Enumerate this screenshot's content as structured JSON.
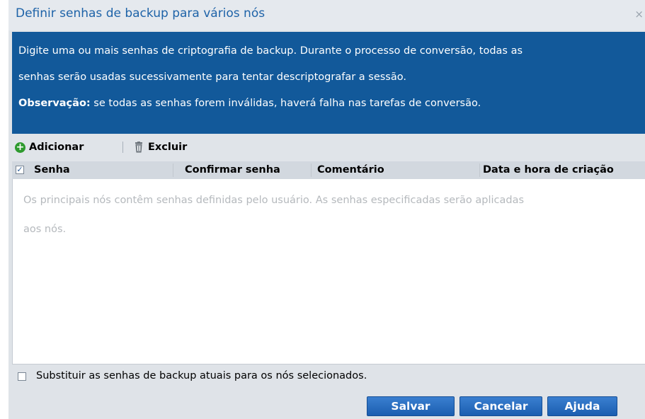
{
  "dialog": {
    "title": "Definir senhas de backup para vários nós",
    "close_glyph": "×"
  },
  "info": {
    "line1": "Digite uma ou mais senhas de criptografia de backup. Durante o processo de conversão, todas as",
    "line2": "senhas serão usadas sucessivamente para tentar descriptografar a sessão.",
    "note_label": "Observação:",
    "note_text": " se todas as senhas forem inválidas, haverá falha nas tarefas de conversão.",
    "background_color": "#12599a"
  },
  "toolbar": {
    "add_label": "Adicionar",
    "delete_label": "Excluir"
  },
  "grid": {
    "select_all_checked": true,
    "columns": [
      "Senha",
      "Confirmar senha",
      "Comentário",
      "Data e hora de criação"
    ],
    "empty_line1": "Os principais nós contêm senhas definidas pelo usuário. As senhas especificadas serão aplicadas",
    "empty_line2": "aos nós."
  },
  "replace_option": {
    "label": "Substituir as senhas de backup atuais para os nós selecionados.",
    "checked": false
  },
  "buttons": {
    "save": "Salvar",
    "cancel": "Cancelar",
    "help": "Ajuda",
    "color": "#1f63b5"
  }
}
